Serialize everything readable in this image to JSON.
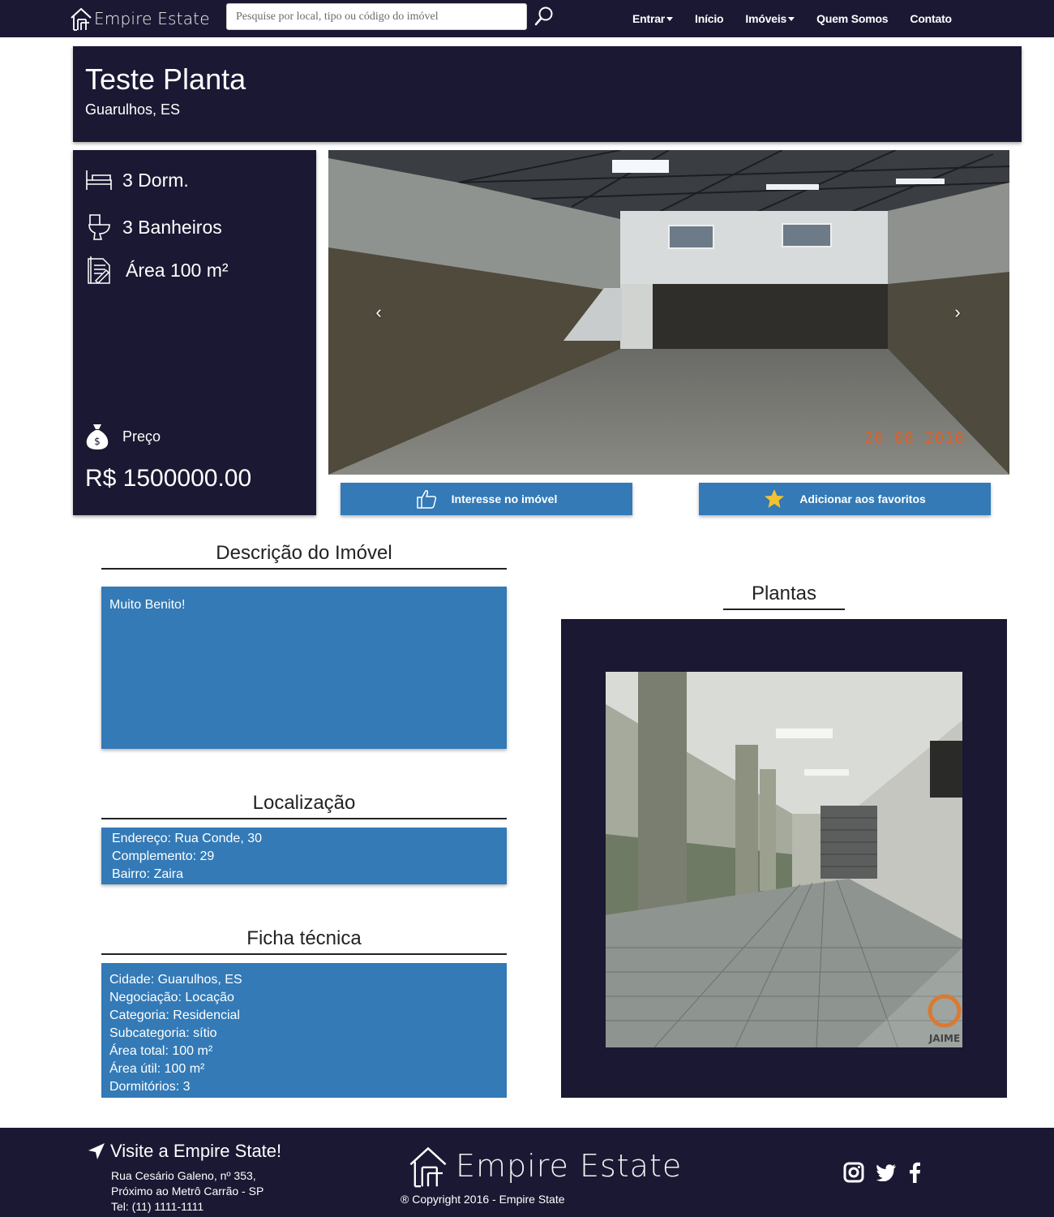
{
  "navbar": {
    "brand": "Empire Estate",
    "search_placeholder": "Pesquise por local, tipo ou código do imóvel",
    "links": [
      {
        "label": "Entrar",
        "dropdown": true
      },
      {
        "label": "Início",
        "dropdown": false
      },
      {
        "label": "Imóveis",
        "dropdown": true
      },
      {
        "label": "Quem Somos",
        "dropdown": false
      },
      {
        "label": "Contato",
        "dropdown": false
      }
    ]
  },
  "property": {
    "title": "Teste Planta",
    "location": "Guarulhos, ES",
    "bedrooms": "3 Dorm.",
    "bathrooms": "3 Banheiros",
    "area": "Área 100 m²",
    "price_label": "Preço",
    "price": "R$ 1500000.00"
  },
  "carousel": {
    "prev": "‹",
    "next": "›",
    "date_stamp": "26 08 2016"
  },
  "actions": {
    "interest": "Interesse no imóvel",
    "favorite": "Adicionar aos favoritos"
  },
  "description": {
    "heading": "Descrição do Imóvel",
    "text": "Muito Benito!"
  },
  "location_section": {
    "heading": "Localização",
    "lines": [
      "Endereço: Rua Conde, 30",
      "Complemento: 29",
      "Bairro: Zaira"
    ]
  },
  "tech_sheet": {
    "heading": "Ficha técnica",
    "lines": [
      "Cidade: Guarulhos, ES",
      "Negociação: Locação",
      "Categoria: Residencial",
      "Subcategoria: sítio",
      "Área total: 100 m²",
      "Área útil: 100 m²",
      "Dormitórios: 3"
    ]
  },
  "plantas": {
    "heading": "Plantas",
    "watermark": "JAIME"
  },
  "footer": {
    "visit_title": "Visite a Empire State!",
    "address_lines": [
      "Rua Cesário Galeno, nº 353,",
      "Próximo ao Metrô Carrão - SP",
      "Tel: (11) 1111-1111"
    ],
    "brand": "Empire Estate",
    "copyright": "® Copyright 2016 - Empire State"
  },
  "colors": {
    "navy": "#1b1833",
    "blue": "#337ab7",
    "white": "#ffffff"
  }
}
